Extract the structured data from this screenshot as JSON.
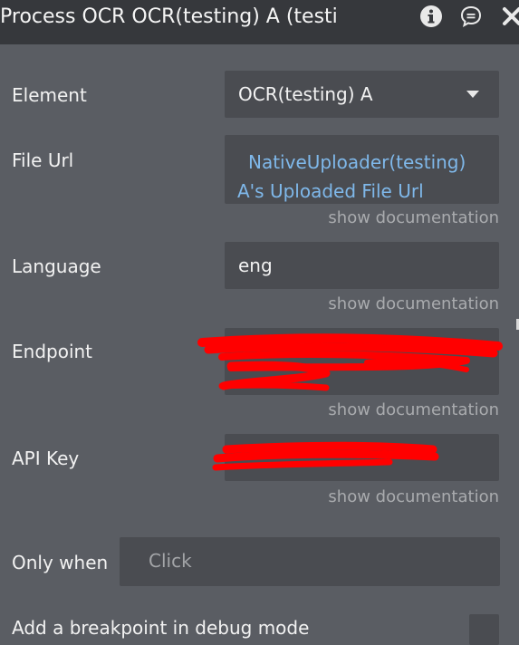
{
  "header": {
    "title": "Process OCR OCR(testing) A (testing)",
    "icons": [
      "info-icon",
      "comment-icon",
      "close-icon"
    ]
  },
  "fields": {
    "element": {
      "label": "Element",
      "value": "OCR(testing) A"
    },
    "file_url": {
      "label": "File Url",
      "value_line1": "NativeUploader(testing)",
      "value_line2": "A's Uploaded File Url",
      "doc": "show documentation"
    },
    "language": {
      "label": "Language",
      "value": "eng",
      "doc": "show documentation"
    },
    "endpoint": {
      "label": "Endpoint",
      "doc": "show documentation"
    },
    "api_key": {
      "label": "API Key",
      "doc": "show documentation"
    },
    "only_when": {
      "label": "Only when",
      "placeholder": "Click"
    },
    "breakpoint": {
      "label": "Add a breakpoint in debug mode"
    }
  },
  "colors": {
    "background": "#5a5d63",
    "header": "#36383c",
    "field": "#4a4c51",
    "link": "#7fb8ea",
    "redaction": "#ff0000"
  }
}
